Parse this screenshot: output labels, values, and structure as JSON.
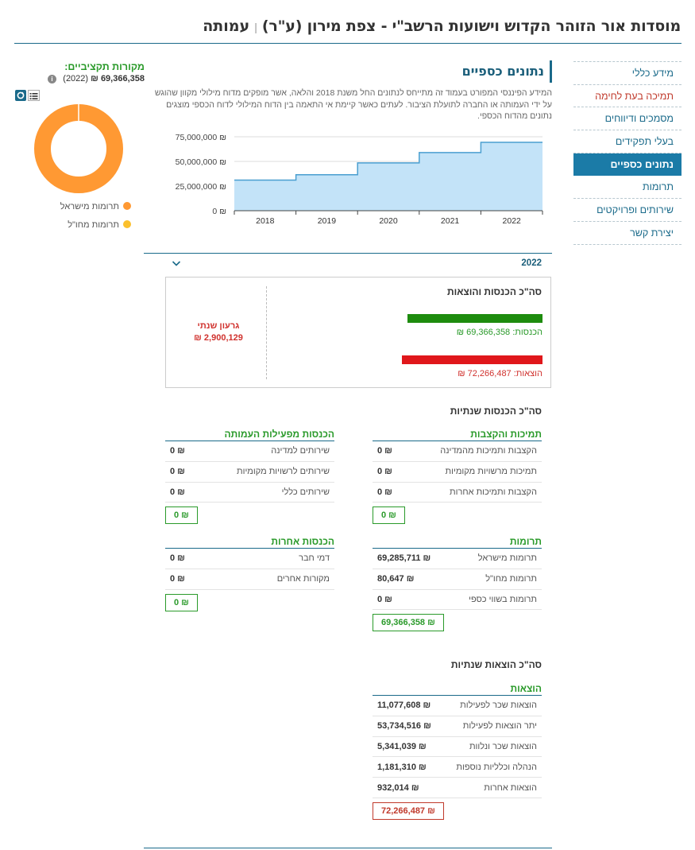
{
  "header": {
    "title": "מוסדות אור הזוהר הקדוש וישועות הרשב\"י - צפת מירון (ע\"ר)",
    "separator": "|",
    "org_type": "עמותה"
  },
  "sidebar": {
    "items": [
      {
        "label": "מידע כללי"
      },
      {
        "label": "תמיכה בעת לחימה"
      },
      {
        "label": "מסמכים ודיווחים"
      },
      {
        "label": "בעלי תפקידים"
      },
      {
        "label": "נתונים כספיים"
      },
      {
        "label": "תרומות"
      },
      {
        "label": "שירותים ופרויקטים"
      },
      {
        "label": "יצירת קשר"
      }
    ]
  },
  "section": {
    "title": "נתונים כספיים",
    "intro": "המידע הפיננסי המפורט בעמוד זה מתייחס לנתונים החל משנת 2018 והלאה, אשר מופקים מדוח מילולי מקוון שהוגש על ידי העמותה או החברה לתועלת הציבור. לעתים כאשר קיימת אי התאמה בין הדוח המילולי לדוח הכספי מוצגים נתונים מהדוח הכספי."
  },
  "chart_data": {
    "type": "area",
    "x": [
      "2018",
      "2019",
      "2020",
      "2021",
      "2022"
    ],
    "series": [
      {
        "values": [
          31000000,
          36500000,
          48500000,
          59000000,
          69366358
        ]
      }
    ],
    "y_ticks": [
      "75,000,000 ₪",
      "50,000,000 ₪",
      "25,000,000 ₪",
      "0 ₪"
    ],
    "ylim": [
      0,
      75000000
    ],
    "grid": true
  },
  "sources": {
    "title": "מקורות תקציביים:",
    "amount": "69,366,358 ₪",
    "year": "(2022)",
    "legend": [
      {
        "label": "תרומות מישראל",
        "color": "#ff9933"
      },
      {
        "label": "תרומות מחו\"ל",
        "color": "#fbc02d"
      }
    ]
  },
  "donut": {
    "slices": [
      {
        "label": "תרומות מישראל",
        "value": 69285711,
        "color": "#ff9933"
      },
      {
        "label": "תרומות מחו\"ל",
        "value": 80647,
        "color": "#fbc02d"
      }
    ]
  },
  "year_panel": {
    "year": "2022"
  },
  "summary": {
    "title": "סה\"כ הכנסות והוצאות",
    "income_label": "הכנסות: 69,366,358 ₪",
    "income_value": 69366358,
    "expense_label": "הוצאות: 72,266,487 ₪",
    "expense_value": 72266487,
    "deficit_title": "גרעון שנתי",
    "deficit_value": "2,900,129 ₪",
    "income_color": "#1e8c0e",
    "expense_color": "#e0171b"
  },
  "annual_income": {
    "title": "סה\"כ הכנסות שנתיות",
    "grants": {
      "title": "תמיכות והקצבות",
      "rows": [
        {
          "label": "הקצבות ותמיכות מהמדינה",
          "value": "0 ₪"
        },
        {
          "label": "תמיכות מרשויות מקומיות",
          "value": "0 ₪"
        },
        {
          "label": "הקצבות ותמיכות אחרות",
          "value": "0 ₪"
        }
      ],
      "total": "0 ₪"
    },
    "activity": {
      "title": "הכנסות מפעילות העמותה",
      "rows": [
        {
          "label": "שירותים למדינה",
          "value": "0 ₪"
        },
        {
          "label": "שירותים לרשויות מקומיות",
          "value": "0 ₪"
        },
        {
          "label": "שירותים כללי",
          "value": "0 ₪"
        }
      ],
      "total": "0 ₪"
    },
    "donations": {
      "title": "תרומות",
      "rows": [
        {
          "label": "תרומות מישראל",
          "value": "69,285,711 ₪"
        },
        {
          "label": "תרומות מחו\"ל",
          "value": "80,647 ₪"
        },
        {
          "label": "תרומות בשווי כספי",
          "value": "0 ₪"
        }
      ],
      "total": "69,366,358 ₪"
    },
    "other": {
      "title": "הכנסות אחרות",
      "rows": [
        {
          "label": "דמי חבר",
          "value": "0 ₪"
        },
        {
          "label": "מקורות אחרים",
          "value": "0 ₪"
        }
      ],
      "total": "0 ₪"
    }
  },
  "annual_expenses": {
    "title": "סה\"כ הוצאות שנתיות",
    "group_title": "הוצאות",
    "rows": [
      {
        "label": "הוצאות שכר לפעילות",
        "value": "11,077,608 ₪"
      },
      {
        "label": "יתר הוצאות לפעילות",
        "value": "53,734,516 ₪"
      },
      {
        "label": "הוצאות שכר ונלוות",
        "value": "5,341,039 ₪"
      },
      {
        "label": "הנהלה וכלליות נוספות",
        "value": "1,181,310 ₪"
      },
      {
        "label": "הוצאות אחרות",
        "value": "932,014 ₪"
      }
    ],
    "total": "72,266,487 ₪"
  }
}
